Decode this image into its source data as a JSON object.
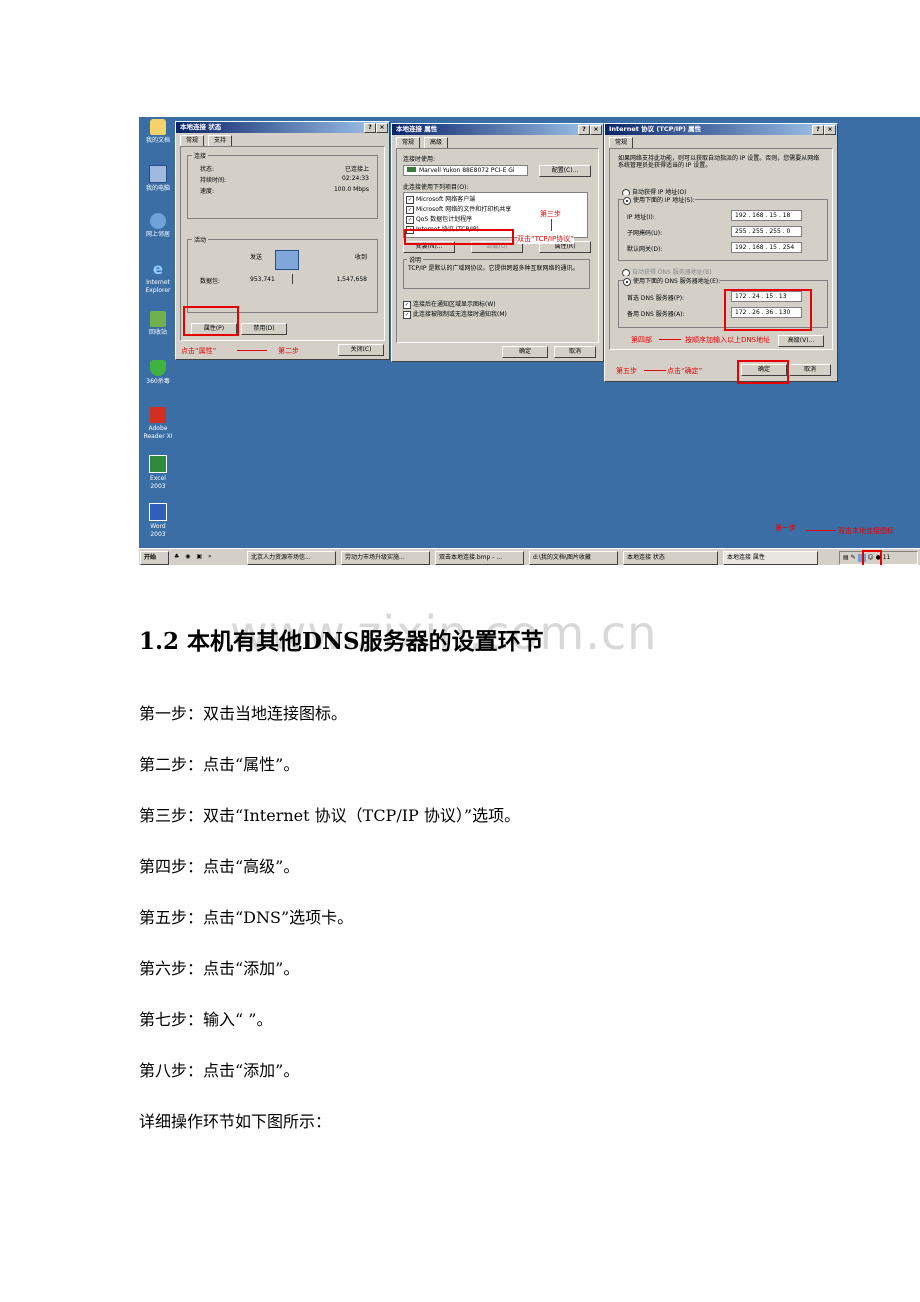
{
  "desktop_icons": [
    {
      "label": "我的文档",
      "icon": "folder-icon"
    },
    {
      "label": "我的电脑",
      "icon": "computer-icon"
    },
    {
      "label": "网上邻居",
      "icon": "network-icon"
    },
    {
      "label": "Internet Explorer",
      "icon": "ie-icon"
    },
    {
      "label": "回收站",
      "icon": "recycle-bin-icon"
    },
    {
      "label": "360杀毒",
      "icon": "shield-icon"
    },
    {
      "label": "Adobe Reader XI",
      "icon": "pdf-icon"
    },
    {
      "label": "Excel 2003",
      "icon": "excel-icon"
    },
    {
      "label": "Word 2003",
      "icon": "word-icon"
    }
  ],
  "status_window": {
    "title": "本地连接 状态",
    "tabs": [
      "常规",
      "支持"
    ],
    "connection_group": "连接",
    "status_label": "状态:",
    "status_value": "已连接上",
    "duration_label": "持续时间:",
    "duration_value": "02:24:33",
    "speed_label": "速度:",
    "speed_value": "100.0 Mbps",
    "activity_group": "活动",
    "sent_label": "发送",
    "received_label": "收到",
    "packets_label": "数据包:",
    "packets_sent": "953,741",
    "packets_received": "1,547,658",
    "properties_button": "属性(P)",
    "disable_button": "禁用(D)",
    "close_button": "关闭(C)"
  },
  "props_window": {
    "title": "本地连接 属性",
    "tabs": [
      "常规",
      "高级"
    ],
    "connect_using_label": "连接时使用:",
    "adapter": "Marvell Yukon 88E8072 PCI-E Gi",
    "configure_button": "配置(C)...",
    "items_label": "此连接使用下列项目(O):",
    "items": [
      "Microsoft 网络客户端",
      "Microsoft 网络的文件和打印机共享",
      "QoS 数据包计划程序",
      "Internet 协议 (TCP/IP)"
    ],
    "install_button": "安装(N)...",
    "uninstall_button": "卸载(U)",
    "properties_button": "属性(R)",
    "desc_group": "说明",
    "desc_text": "TCP/IP 是默认的广域网协议。它提供跨越多种互联网络的通讯。",
    "check_show_icon": "连接后在通知区域显示图标(W)",
    "check_notify": "此连接被限制或无连接时通知我(M)",
    "ok_button": "确定",
    "cancel_button": "取消"
  },
  "tcpip_window": {
    "title": "Internet 协议 (TCP/IP) 属性",
    "tab": "常规",
    "intro": "如果网络支持此功能，则可以获取自动指派的 IP 设置。否则，您需要从网络系统管理员处获得适当的 IP 设置。",
    "auto_ip": "自动获得 IP 地址(O)",
    "manual_ip": "使用下面的 IP 地址(S):",
    "ip_label": "IP 地址(I):",
    "ip_value": "192 . 168 . 15 . 18",
    "mask_label": "子网掩码(U):",
    "mask_value": "255 . 255 . 255 . 0",
    "gateway_label": "默认网关(D):",
    "gateway_value": "192 . 168 . 15 . 254",
    "auto_dns": "自动获得 DNS 服务器地址(B)",
    "manual_dns": "使用下面的 DNS 服务器地址(E):",
    "dns1_label": "首选 DNS 服务器(P):",
    "dns1_value": "172 . 24 . 15 . 13",
    "dns2_label": "备用 DNS 服务器(A):",
    "dns2_value": "172 . 26 . 36 . 130",
    "advanced_button": "高级(V)...",
    "ok_button": "确定",
    "cancel_button": "取消"
  },
  "annotations": {
    "step1": "第一步",
    "step1_desc": "双击本地连接图标",
    "step2": "第二步",
    "step2_desc": "点击“属性”",
    "step3": "第三步",
    "step3_desc": "双击“TCP/IP协议”",
    "step4": "第四部",
    "step4_desc": "按顺序加输入以上DNS地址",
    "step5": "第五步",
    "step5_desc": "点击“确定”"
  },
  "taskbar": {
    "start": "开始",
    "items": [
      "北京人力资源市场信...",
      "劳动力市场升级实施...",
      "双击本地连接.bmp - ...",
      "d:\\我的文档\\图片收藏",
      "本地连接 状态",
      "本地连接 属性"
    ],
    "clock": "11"
  },
  "watermark": "www.zixin.com.cn",
  "heading": "1.2 本机有其他DNS服务器的设置环节",
  "steps": [
    "第一步：双击当地连接图标。",
    "第二步：点击“属性”。",
    "第三步：双击“Internet 协议（TCP/IP 协议）”选项。",
    "第四步：点击“高级”。",
    "第五步：点击“DNS”选项卡。",
    "第六步：点击“添加”。",
    "第七步：输入“ ”。",
    "第八步：点击“添加”。",
    "详细操作环节如下图所示："
  ]
}
